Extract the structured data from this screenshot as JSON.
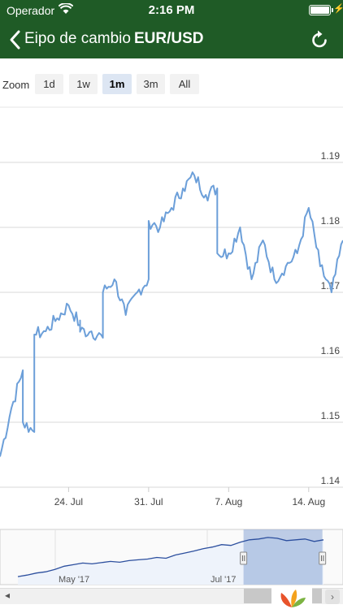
{
  "status": {
    "carrier": "Operador",
    "time": "2:16 PM",
    "icons": [
      "wifi-icon",
      "battery-icon",
      "charging-bolt-icon"
    ]
  },
  "nav": {
    "title": "Eipo de cambio",
    "pair": "EUR/USD",
    "back_icon": "chevron-left-icon",
    "refresh_icon": "refresh-icon"
  },
  "zoom": {
    "label": "Zoom",
    "buttons": [
      {
        "label": "1d",
        "active": false
      },
      {
        "label": "1w",
        "active": false
      },
      {
        "label": "1m",
        "active": true
      },
      {
        "label": "3m",
        "active": false
      },
      {
        "label": "All",
        "active": false
      }
    ]
  },
  "colors": {
    "brand": "#1f5b26",
    "series": "#6c9fd9",
    "nav_fill": "#eef3fb",
    "nav_selection": "#8ba6d6"
  },
  "chart_data": {
    "type": "line",
    "x_labels": [
      "24. Jul",
      "31. Jul",
      "7. Aug",
      "14. Aug"
    ],
    "y_ticks": [
      1.14,
      1.15,
      1.16,
      1.17,
      1.18,
      1.19
    ],
    "ylim": [
      1.14,
      1.2
    ],
    "xlim": [
      "2017-07-18",
      "2017-08-17"
    ],
    "grid": true,
    "series": [
      {
        "x": [
          "2017-07-18",
          "2017-07-19",
          "2017-07-20",
          "2017-07-20",
          "2017-07-21",
          "2017-07-21",
          "2017-07-22",
          "2017-07-23",
          "2017-07-24",
          "2017-07-25",
          "2017-07-25",
          "2017-07-26",
          "2017-07-27",
          "2017-07-27",
          "2017-07-28",
          "2017-07-29",
          "2017-07-30",
          "2017-07-31",
          "2017-07-31",
          "2017-08-01",
          "2017-08-02",
          "2017-08-03",
          "2017-08-04",
          "2017-08-05",
          "2017-08-06",
          "2017-08-06",
          "2017-08-07",
          "2017-08-08",
          "2017-08-09",
          "2017-08-10",
          "2017-08-11",
          "2017-08-12",
          "2017-08-13",
          "2017-08-14",
          "2017-08-15",
          "2017-08-16",
          "2017-08-17"
        ],
        "values": [
          1.1447,
          1.1522,
          1.158,
          1.15,
          1.1485,
          1.1635,
          1.164,
          1.166,
          1.168,
          1.165,
          1.164,
          1.164,
          1.163,
          1.17,
          1.172,
          1.1665,
          1.17,
          1.172,
          1.181,
          1.18,
          1.183,
          1.186,
          1.188,
          1.185,
          1.186,
          1.176,
          1.176,
          1.18,
          1.172,
          1.178,
          1.172,
          1.174,
          1.176,
          1.183,
          1.174,
          1.17,
          1.178
        ]
      }
    ],
    "navigator": {
      "x_labels": [
        "May '17",
        "Jul '17"
      ],
      "values": [
        1.086,
        1.09,
        1.095,
        1.098,
        1.104,
        1.112,
        1.116,
        1.12,
        1.118,
        1.121,
        1.124,
        1.122,
        1.126,
        1.128,
        1.13,
        1.134,
        1.132,
        1.14,
        1.145,
        1.15,
        1.156,
        1.16,
        1.166,
        1.164,
        1.172,
        1.178,
        1.18,
        1.184,
        1.182,
        1.176,
        1.178,
        1.18,
        1.174,
        1.178
      ],
      "ylim": [
        1.07,
        1.2
      ],
      "selection_fraction": [
        0.71,
        0.94
      ]
    }
  }
}
